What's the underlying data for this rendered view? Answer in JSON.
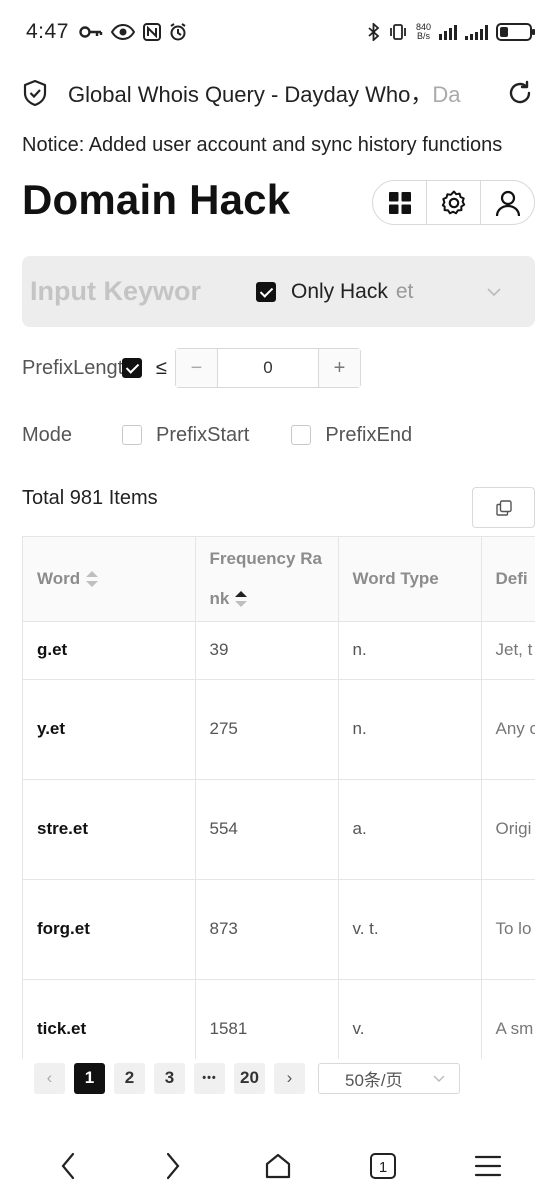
{
  "status_bar": {
    "time": "4:47",
    "net_speed_value": "840",
    "net_speed_unit": "B/s",
    "battery_level": 0.3
  },
  "browser": {
    "page_title": "Global Whois Query - Dayday Who，",
    "page_title_overflow": "Da",
    "tab_count": "1"
  },
  "notice": "Notice: Added user account and sync history functions",
  "heading": "Domain Hack",
  "search": {
    "placeholder": "Input Keywor",
    "only_hack_label": "Only Hack",
    "only_hack_checked": true,
    "tld": "et"
  },
  "prefix_length": {
    "label": "PrefixLengt",
    "le_symbol": "≤",
    "checked": true,
    "value": "0",
    "minus": "−",
    "plus": "+"
  },
  "mode": {
    "label": "Mode",
    "options": [
      {
        "label": "PrefixStart",
        "checked": false
      },
      {
        "label": "PrefixEnd",
        "checked": false
      }
    ]
  },
  "total": "Total 981 Items",
  "table": {
    "headers": {
      "word": "Word",
      "frequency": "Frequency Ra",
      "frequency_wrap": "nk",
      "word_type": "Word Type",
      "definition": "Defi"
    },
    "rows": [
      {
        "word": "g.et",
        "rank": "39",
        "type": "n.",
        "def": "Jet, t"
      },
      {
        "word": "y.et",
        "rank": "275",
        "type": "n.",
        "def": "Any c ods b t she"
      },
      {
        "word": "stre.et",
        "rank": "554",
        "type": "a.",
        "def": "Origi now bord"
      },
      {
        "word": "forg.et",
        "rank": "873",
        "type": "v. t.",
        "def": "To lo mory o, to"
      },
      {
        "word": "tick.et",
        "rank": "1581",
        "type": "v.",
        "def": "A sm ng as f"
      }
    ]
  },
  "pagination": {
    "prev": "‹",
    "pages": [
      "1",
      "2",
      "3"
    ],
    "ellipsis": "•••",
    "last": "20",
    "next": "›",
    "page_size": "50条/页"
  }
}
